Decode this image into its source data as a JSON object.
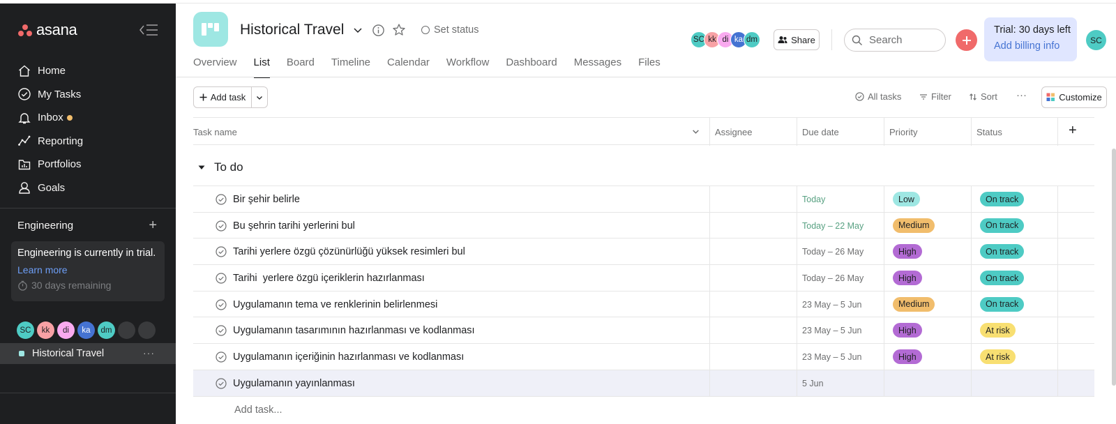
{
  "sidebar": {
    "logo_text": "asana",
    "nav": [
      {
        "label": "Home",
        "icon": "home-icon"
      },
      {
        "label": "My Tasks",
        "icon": "check-circle-icon"
      },
      {
        "label": "Inbox",
        "icon": "bell-icon"
      },
      {
        "label": "Reporting",
        "icon": "chart-line-icon"
      },
      {
        "label": "Portfolios",
        "icon": "folder-chart-icon"
      },
      {
        "label": "Goals",
        "icon": "person-icon"
      }
    ],
    "team_name": "Engineering",
    "team_add": "+",
    "trial_box": {
      "message": "Engineering is currently in trial.",
      "link": "Learn more",
      "remaining": "30 days remaining"
    },
    "members": [
      {
        "initials": "SC",
        "color": "#4ecbc4"
      },
      {
        "initials": "kk",
        "color": "#f8a1a5"
      },
      {
        "initials": "di",
        "color": "#f9aaef"
      },
      {
        "initials": "ka",
        "color": "#4573d2"
      },
      {
        "initials": "dm",
        "color": "#4ecbc4"
      }
    ],
    "project": {
      "name": "Historical Travel",
      "more": "···"
    }
  },
  "header": {
    "project_title": "Historical Travel",
    "set_status": "Set status",
    "tabs": [
      "Overview",
      "List",
      "Board",
      "Timeline",
      "Calendar",
      "Workflow",
      "Dashboard",
      "Messages",
      "Files"
    ],
    "active_tab": "List",
    "members": [
      {
        "initials": "SC",
        "color": "#4ecbc4"
      },
      {
        "initials": "kk",
        "color": "#f8a1a5"
      },
      {
        "initials": "di",
        "color": "#f9aaef"
      },
      {
        "initials": "ka",
        "color": "#4573d2"
      },
      {
        "initials": "dm",
        "color": "#4ecbc4"
      }
    ],
    "share_label": "Share",
    "search_placeholder": "Search",
    "trial": {
      "days_left": "Trial: 30 days left",
      "billing": "Add billing info"
    },
    "user_initials": "SC"
  },
  "toolbar": {
    "add_task": "Add task",
    "all_tasks": "All tasks",
    "filter": "Filter",
    "sort": "Sort",
    "more": "···",
    "customize": "Customize"
  },
  "table": {
    "columns": {
      "task_name": "Task name",
      "assignee": "Assignee",
      "due_date": "Due date",
      "priority": "Priority",
      "status": "Status",
      "add": "+"
    },
    "section": "To do",
    "rows": [
      {
        "name": "Bir şehir belirle",
        "due": "Today",
        "due_green": true,
        "priority": "Low",
        "priority_color": "#9ee7e3",
        "status": "On track",
        "status_color": "#4ecbc4"
      },
      {
        "name": "Bu şehrin tarihi yerlerini bul",
        "due": "Today – 22 May",
        "due_green": true,
        "priority": "Medium",
        "priority_color": "#f1bd6c",
        "status": "On track",
        "status_color": "#4ecbc4"
      },
      {
        "name": "Tarihi yerlere özgü çözünürlüğü yüksek resimleri bul",
        "due": "Today – 26 May",
        "due_green": false,
        "priority": "High",
        "priority_color": "#b36bd4",
        "status": "On track",
        "status_color": "#4ecbc4"
      },
      {
        "name": "Tarihi  yerlere özgü içeriklerin hazırlanması",
        "due": "Today – 26 May",
        "due_green": false,
        "priority": "High",
        "priority_color": "#b36bd4",
        "status": "On track",
        "status_color": "#4ecbc4"
      },
      {
        "name": "Uygulamanın tema ve renklerinin belirlenmesi",
        "due": "23 May – 5 Jun",
        "due_green": false,
        "priority": "Medium",
        "priority_color": "#f1bd6c",
        "status": "On track",
        "status_color": "#4ecbc4"
      },
      {
        "name": "Uygulamanın tasarımının hazırlanması ve kodlanması",
        "due": "23 May – 5 Jun",
        "due_green": false,
        "priority": "High",
        "priority_color": "#b36bd4",
        "status": "At risk",
        "status_color": "#f8df72"
      },
      {
        "name": "Uygulamanın içeriğinin hazırlanması ve kodlanması",
        "due": "23 May – 5 Jun",
        "due_green": false,
        "priority": "High",
        "priority_color": "#b36bd4",
        "status": "At risk",
        "status_color": "#f8df72"
      },
      {
        "name": "Uygulamanın yayınlanması",
        "due": "5 Jun",
        "due_green": false,
        "priority": "",
        "priority_color": "",
        "status": "",
        "status_color": ""
      }
    ],
    "add_task_row": "Add task..."
  },
  "colors": {
    "sidebar_bg": "#1e1f21",
    "accent_red": "#f06a6a",
    "project_teal": "#9ee7e3",
    "trial_bg": "#e0e6ff",
    "link_blue": "#4573d2"
  }
}
